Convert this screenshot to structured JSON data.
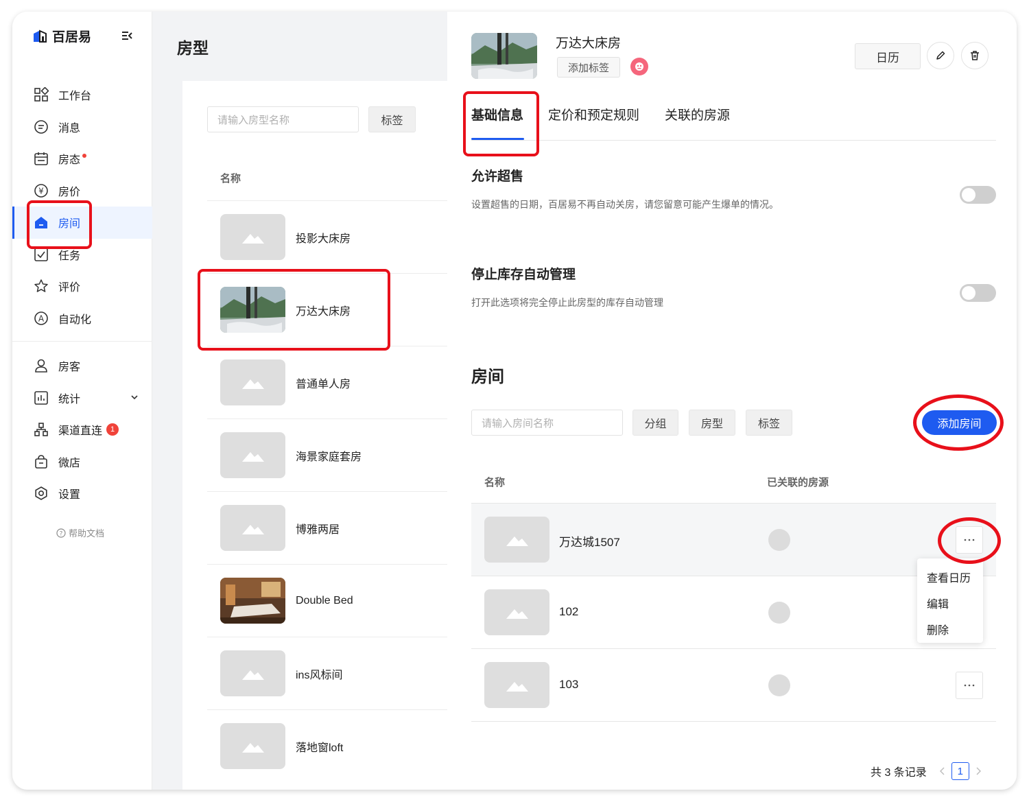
{
  "brand": {
    "name": "百居易"
  },
  "sidebar": {
    "items": [
      {
        "label": "工作台",
        "icon": "dashboard-icon"
      },
      {
        "label": "消息",
        "icon": "message-icon"
      },
      {
        "label": "房态",
        "icon": "calendar-icon",
        "dot": true
      },
      {
        "label": "房价",
        "icon": "yen-icon"
      },
      {
        "label": "房间",
        "icon": "house-icon",
        "active": true
      },
      {
        "label": "任务",
        "icon": "task-icon"
      },
      {
        "label": "评价",
        "icon": "star-icon"
      },
      {
        "label": "自动化",
        "icon": "automation-icon"
      }
    ],
    "items2": [
      {
        "label": "房客",
        "icon": "user-icon"
      },
      {
        "label": "统计",
        "icon": "chart-icon",
        "chevron": true
      },
      {
        "label": "渠道直连",
        "icon": "channel-icon",
        "badge": "1"
      },
      {
        "label": "微店",
        "icon": "shop-icon"
      },
      {
        "label": "设置",
        "icon": "settings-icon"
      }
    ],
    "help": "帮助文档"
  },
  "middle": {
    "title": "房型",
    "search_placeholder": "请输入房型名称",
    "tag_filter": "标签",
    "col_name": "名称",
    "rows": [
      {
        "name": "投影大床房",
        "image": "placeholder"
      },
      {
        "name": "万达大床房",
        "image": "photo-mountain"
      },
      {
        "name": "普通单人房",
        "image": "placeholder"
      },
      {
        "name": "海景家庭套房",
        "image": "placeholder"
      },
      {
        "name": "博雅两居",
        "image": "placeholder"
      },
      {
        "name": "Double Bed",
        "image": "photo-room"
      },
      {
        "name": "ins风标间",
        "image": "placeholder"
      },
      {
        "name": "落地窗loft",
        "image": "placeholder"
      }
    ]
  },
  "detail": {
    "title": "万达大床房",
    "add_tag": "添加标签",
    "calendar_btn": "日历",
    "tabs": [
      "基础信息",
      "定价和预定规则",
      "关联的房源"
    ],
    "overbooking": {
      "title": "允许超售",
      "desc": "设置超售的日期，百居易不再自动关房，请您留意可能产生爆单的情况。",
      "enabled": false
    },
    "stop_inventory": {
      "title": "停止库存自动管理",
      "desc": "打开此选项将完全停止此房型的库存自动管理",
      "enabled": false
    },
    "rooms": {
      "title": "房间",
      "search_placeholder": "请输入房间名称",
      "filters": [
        "分组",
        "房型",
        "标签"
      ],
      "add_btn": "添加房间",
      "col_name": "名称",
      "col_linked": "已关联的房源",
      "rows": [
        {
          "name": "万达城1507"
        },
        {
          "name": "102"
        },
        {
          "name": "103"
        }
      ],
      "menu": [
        "查看日历",
        "编辑",
        "删除"
      ],
      "total": "共 3 条记录",
      "page": "1"
    }
  },
  "colors": {
    "accent": "#1e5bf0",
    "highlight": "#e8101a",
    "badge": "#f0433a"
  }
}
